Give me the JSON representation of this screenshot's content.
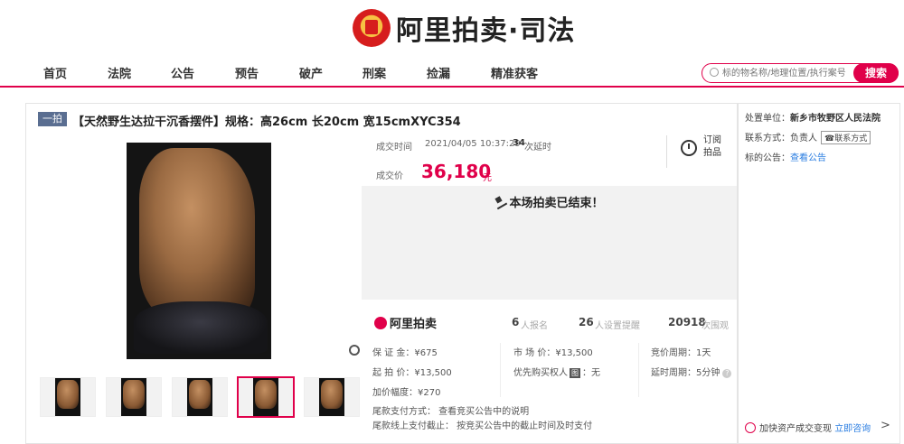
{
  "header": {
    "logo_text": "阿里拍卖·司法",
    "nav": [
      "首页",
      "法院",
      "公告",
      "预告",
      "破产",
      "刑案",
      "捡漏",
      "精准获客"
    ],
    "search": {
      "placeholder": "标的物名称/地理位置/执行案号",
      "button": "搜索"
    }
  },
  "item": {
    "badge": "一拍",
    "title": "【天然野生达拉干沉香摆件】规格：高26cm 长20cm 宽15cmXYC354"
  },
  "deal": {
    "time_label": "成交时间",
    "time_value": "2021/04/05 10:37:29",
    "delay_count": "34",
    "delay_label": "次延时",
    "price_label": "成交价",
    "price": "36,180",
    "price_unit": "元",
    "subscribe_label": "订阅拍品",
    "ended_text": "本场拍卖已结束！"
  },
  "stats": {
    "brand": "阿里拍卖",
    "signups": "6",
    "signups_label": "人报名",
    "reminders": "26",
    "reminders_label": "人设置提醒",
    "views": "20918",
    "views_label": "次围观"
  },
  "details": {
    "deposit": "保 证 金：¥675",
    "market_price": "市 场 价：¥13,500",
    "bid_cycle": "竞价周期：1天",
    "start_price": "起 拍 价：¥13,500",
    "priority": "优先购买权人",
    "priority_badge": "图",
    "priority_value": "：无",
    "delay_cycle": "延时周期：5分钟",
    "increment": "加价幅度：¥270",
    "payment_method": "尾款支付方式：  查看竞买公告中的说明",
    "payment_deadline": "尾款线上支付截止：  按竞买公告中的截止时间及时支付"
  },
  "side": {
    "unit_label": "处置单位：",
    "unit_value": "新乡市牧野区人民法院",
    "contact_label": "联系方式：",
    "contact_person": "负责人",
    "contact_btn": "联系方式",
    "notice_label": "标的公告：",
    "notice_link": "查看公告",
    "promo_text": "加快资产成交变现",
    "promo_link": "立即咨询",
    "promo_arrow": ">"
  },
  "colors": {
    "accent": "#e0004a",
    "link": "#2a7de1",
    "badge": "#5a6e91"
  }
}
